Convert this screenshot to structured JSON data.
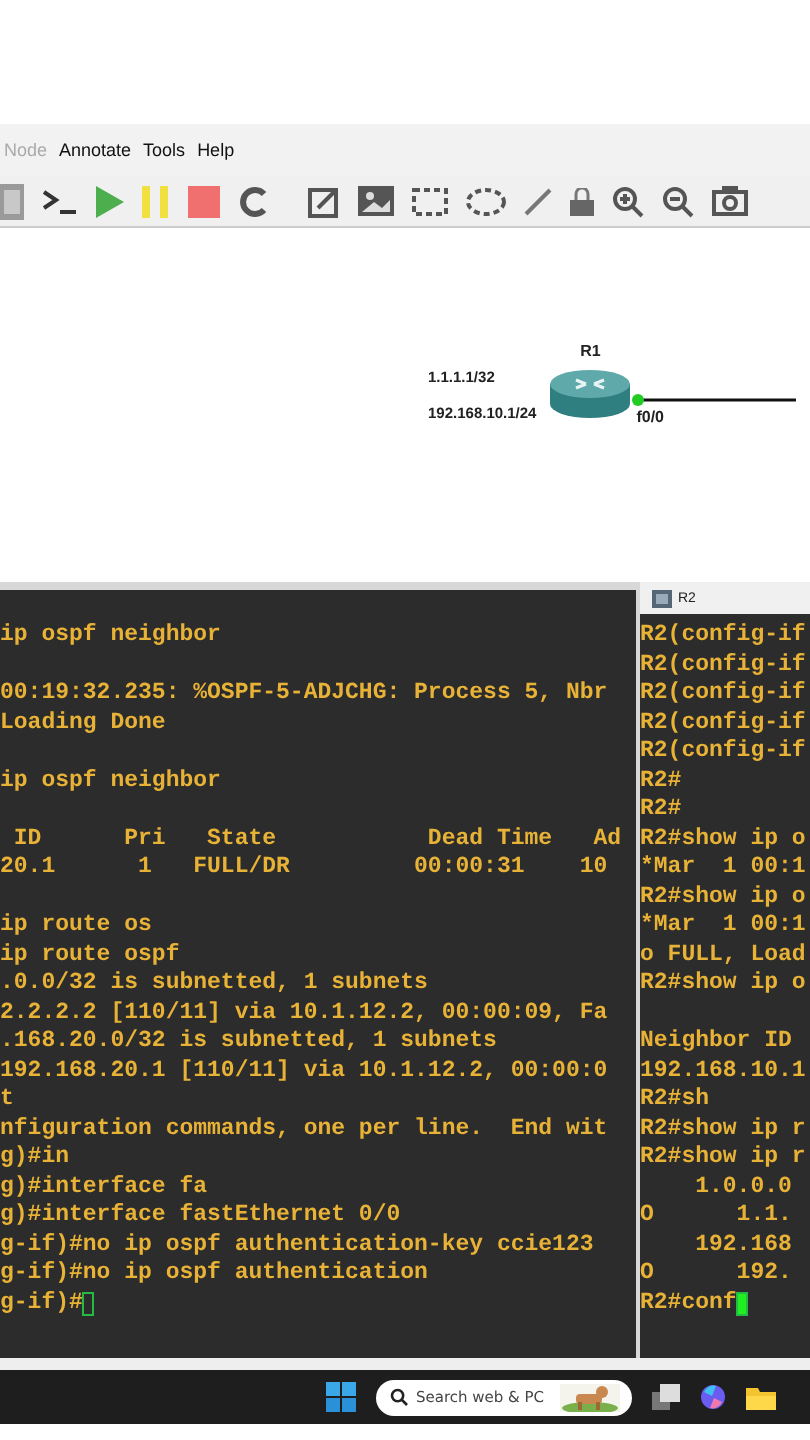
{
  "menu": [
    {
      "label": "Node",
      "disabled": true
    },
    {
      "label": "Annotate",
      "disabled": false
    },
    {
      "label": "Tools",
      "disabled": false
    },
    {
      "label": "Help",
      "disabled": false
    }
  ],
  "canvas": {
    "node": {
      "name": "R1",
      "port": "f0/0",
      "labels": [
        "1.1.1.1/32",
        "192.168.10.1/24"
      ]
    }
  },
  "terminals": [
    {
      "focused": false,
      "blocks": [
        {
          "lines": [
            "ip ospf neighbor"
          ]
        },
        {
          "lines": [
            "00:19:32.235: %OSPF-5-ADJCHG: Process 5, Nbr",
            "Loading Done"
          ]
        },
        {
          "lines": [
            "ip ospf neighbor"
          ]
        },
        {
          "lines": [
            " ID      Pri   State           Dead Time   Ad",
            "20.1      1   FULL/DR         00:00:31    10"
          ]
        },
        {
          "lines": [
            "ip route os",
            "ip route ospf",
            ".0.0/32 is subnetted, 1 subnets",
            "2.2.2.2 [110/11] via 10.1.12.2, 00:00:09, Fa",
            ".168.20.0/32 is subnetted, 1 subnets",
            "192.168.20.1 [110/11] via 10.1.12.2, 00:00:0",
            "t",
            "nfiguration commands, one per line.  End wit",
            "g)#in",
            "g)#interface fa",
            "g)#interface fastEthernet 0/0",
            "g-if)#no ip ospf authentication-key ccie123",
            "g-if)#no ip ospf authentication",
            "g-if)#"
          ]
        }
      ]
    },
    {
      "title": "R2",
      "focused": true,
      "blocks": [
        {
          "lines": [
            "R2(config-if",
            "R2(config-if",
            "R2(config-if",
            "R2(config-if",
            "R2(config-if",
            "R2#",
            "R2#",
            "R2#show ip o",
            "*Mar  1 00:1",
            "R2#show ip o",
            "*Mar  1 00:1",
            "o FULL, Load",
            "R2#show ip o"
          ]
        },
        {
          "lines": [
            "Neighbor ID",
            "192.168.10.1",
            "R2#sh",
            "R2#show ip r",
            "R2#show ip r",
            "    1.0.0.0",
            "O      1.1.",
            "    192.168",
            "O      192.",
            "R2#conf"
          ]
        }
      ]
    }
  ],
  "taskbar": {
    "search": {
      "placeholder": "Search web & PC"
    }
  }
}
